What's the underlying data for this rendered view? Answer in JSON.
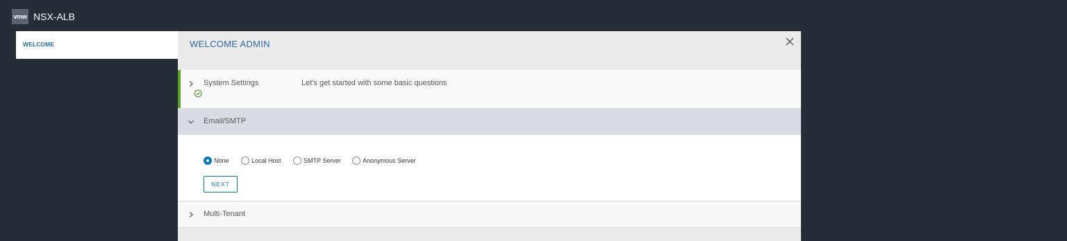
{
  "app": {
    "logo_text": "vmw",
    "title": "NSX-ALB"
  },
  "sidebar": {
    "items": [
      {
        "label": "WELCOME",
        "active": true
      }
    ]
  },
  "modal": {
    "title": "WELCOME ADMIN",
    "close_icon": "close-icon",
    "sections": {
      "system_settings": {
        "label": "System Settings",
        "description": "Let's get started with some basic questions",
        "expanded": false,
        "completed": true,
        "status_icon": "check-circle-icon"
      },
      "email_smtp": {
        "label": "Email/SMTP",
        "expanded": true,
        "options": [
          {
            "label": "None",
            "selected": true
          },
          {
            "label": "Local Host",
            "selected": false
          },
          {
            "label": "SMTP Server",
            "selected": false
          },
          {
            "label": "Anonymous Server",
            "selected": false
          }
        ],
        "next_label": "NEXT"
      },
      "multi_tenant": {
        "label": "Multi-Tenant",
        "expanded": false
      }
    }
  },
  "colors": {
    "background": "#252d37",
    "accent_blue": "#0079b8",
    "success_green": "#5aa220",
    "section_active": "#d8dde4"
  }
}
